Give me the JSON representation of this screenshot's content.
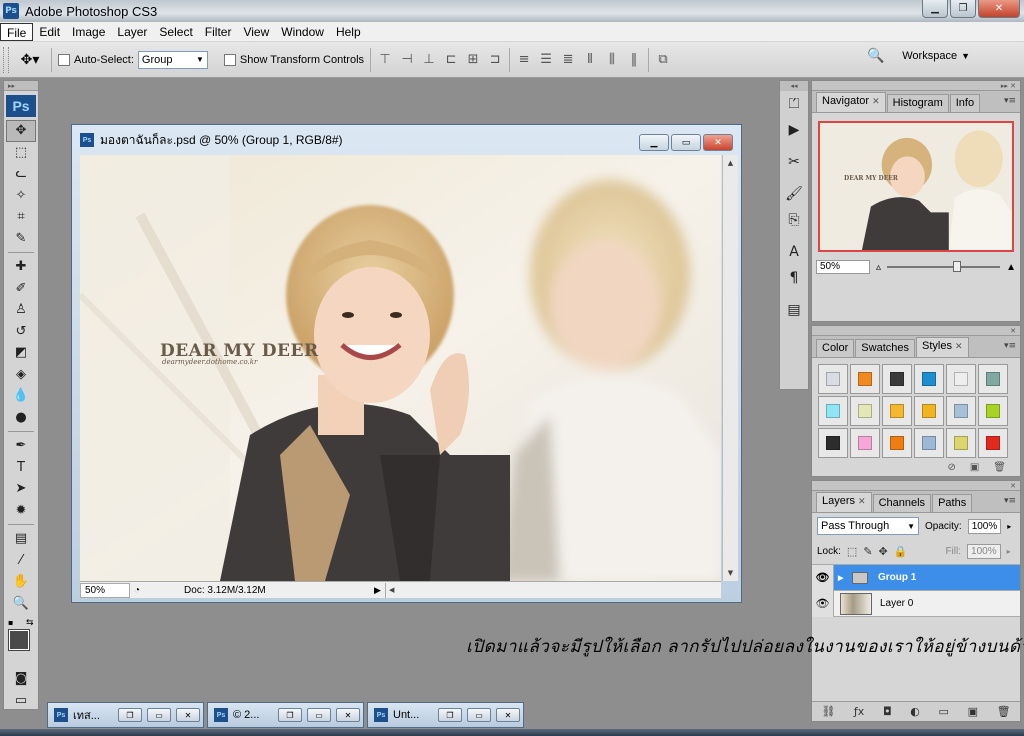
{
  "app": {
    "title": "Adobe Photoshop CS3",
    "ps_badge": "Ps"
  },
  "menu": [
    "File",
    "Edit",
    "Image",
    "Layer",
    "Select",
    "Filter",
    "View",
    "Window",
    "Help"
  ],
  "options": {
    "auto_select_label": "Auto-Select:",
    "auto_select_value": "Group",
    "show_transform_label": "Show Transform Controls",
    "workspace_label": "Workspace"
  },
  "document": {
    "title": "มองตาฉันก็ละ.psd @ 50% (Group 1, RGB/8#)",
    "zoom": "50%",
    "doc_info": "Doc: 3.12M/3.12M",
    "image_text_title": "DEAR MY DEER",
    "image_text_sub": "dearmydeer.dothome.co.kr"
  },
  "navigator": {
    "tabs": [
      "Navigator",
      "Histogram",
      "Info"
    ],
    "zoom": "50%",
    "thumb_text": "DEAR MY DEER"
  },
  "swatches_panel": {
    "tabs": [
      "Color",
      "Swatches",
      "Styles"
    ],
    "styles": [
      "#d9dde3",
      "#f08a1e",
      "#3a3a3a",
      "#1d8fd1",
      "#eeeeee",
      "#7fa8a0",
      "#8fe6f7",
      "#e3e7b5",
      "#f3b82e",
      "#f0b421",
      "#a7c0d8",
      "#a7d424",
      "#2d2d2d",
      "#f7a6d8",
      "#f07d12",
      "#9db8d6",
      "#dcd46c",
      "#e02a1c"
    ]
  },
  "layers_panel": {
    "tabs": [
      "Layers",
      "Channels",
      "Paths"
    ],
    "blend_mode": "Pass Through",
    "opacity_label": "Opacity:",
    "opacity_value": "100%",
    "lock_label": "Lock:",
    "fill_label": "Fill:",
    "fill_value": "100%",
    "layers": [
      {
        "name": "Group 1",
        "selected": true,
        "type": "group"
      },
      {
        "name": "Layer 0",
        "selected": false,
        "type": "image"
      }
    ]
  },
  "minimized_windows": [
    "เทส...",
    "© 2...",
    "Unt..."
  ],
  "caption": "เปิดมาแล้วจะมีรูปให้เลือก ลากรัปไปปล่อยลงในงานของเราให้อยู่ข้างบนด้วยนะ"
}
